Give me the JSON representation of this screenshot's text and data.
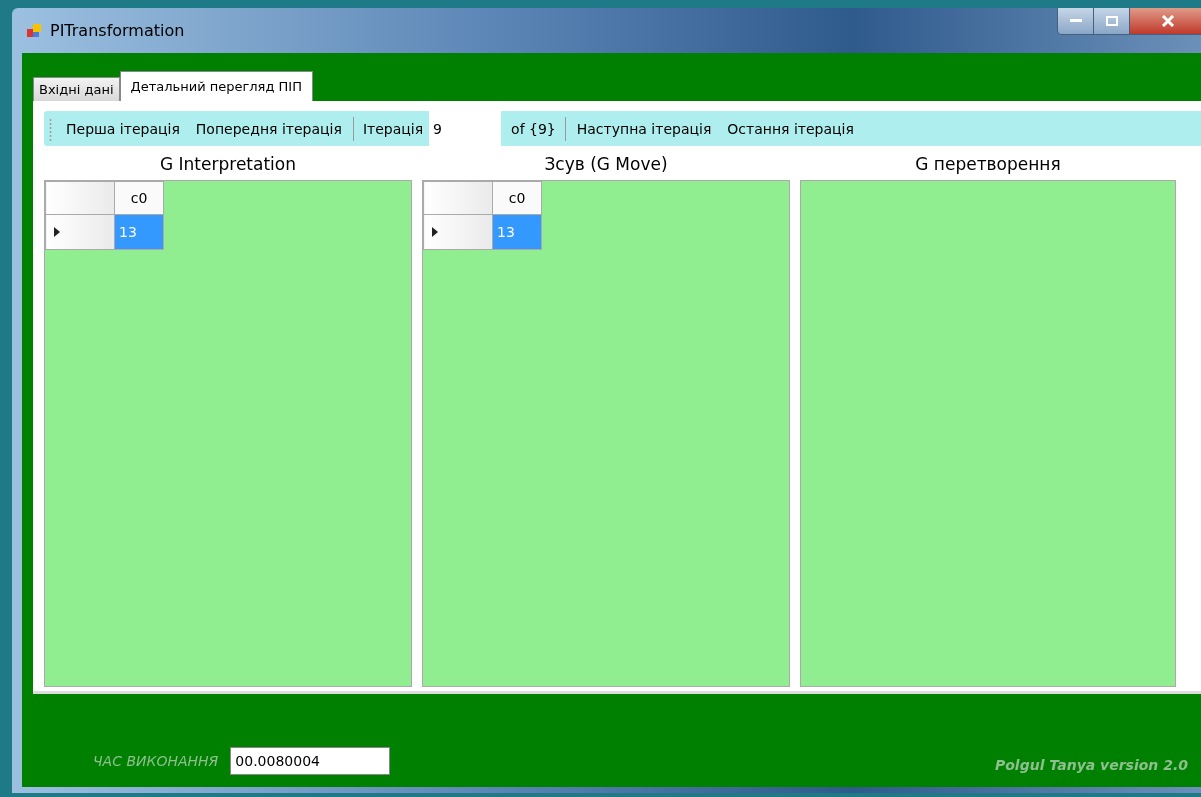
{
  "window": {
    "title": "PITransformation"
  },
  "tabs": [
    {
      "label": "Вхідні дані",
      "selected": false
    },
    {
      "label": "Детальний перегляд ПІП",
      "selected": true
    }
  ],
  "toolbar": [
    {
      "kind": "button",
      "label": "Перша ітерація"
    },
    {
      "kind": "button",
      "label": "Попередня ітерація"
    },
    {
      "kind": "separator"
    },
    {
      "kind": "label",
      "label": "Ітерація"
    },
    {
      "kind": "field",
      "value": "9"
    },
    {
      "kind": "label",
      "label": "of {9}"
    },
    {
      "kind": "separator"
    },
    {
      "kind": "button",
      "label": "Наступна ітерація"
    },
    {
      "kind": "button",
      "label": "Остання ітерація"
    }
  ],
  "panels": [
    {
      "title": "G Interpretation",
      "grid": {
        "columns": [
          "c0"
        ],
        "rows": [
          {
            "current": true,
            "cells": [
              {
                "value": "13",
                "selected": true
              }
            ]
          }
        ]
      }
    },
    {
      "title": "Зсув (G Move)",
      "grid": {
        "columns": [
          "c0"
        ],
        "rows": [
          {
            "current": true,
            "cells": [
              {
                "value": "13",
                "selected": true
              }
            ]
          }
        ]
      }
    },
    {
      "title": "G перетворення"
    }
  ],
  "footer": {
    "time_label": "ЧАС ВИКОНАННЯ",
    "time_value": "00.0080004",
    "version": "Polgul Tanya version 2.0"
  }
}
